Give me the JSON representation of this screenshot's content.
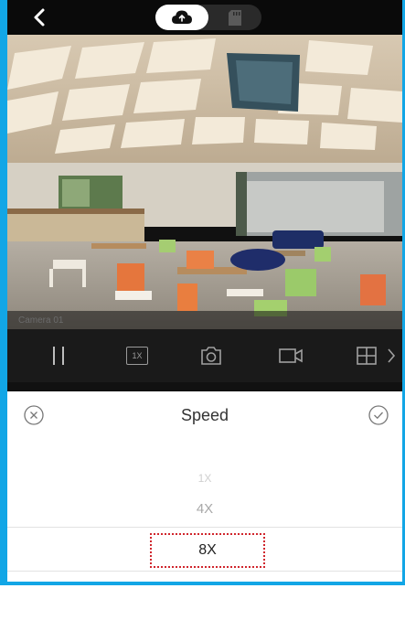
{
  "top_bar": {
    "back_icon": "chevron-left-icon",
    "source_toggle": {
      "selected": "cloud",
      "options": [
        "cloud-icon",
        "sd-card-icon"
      ]
    }
  },
  "video": {
    "camera_label": "Camera 01"
  },
  "toolbar": {
    "speed_badge": "1X",
    "icons": [
      "pause-icon",
      "speed-icon",
      "snapshot-icon",
      "record-icon",
      "grid-icon",
      "chevron-right-icon"
    ]
  },
  "speed_sheet": {
    "title": "Speed",
    "options": [
      "1X",
      "4X",
      "8X"
    ],
    "selected": "8X"
  },
  "colors": {
    "frame": "#12a6e6",
    "highlight": "#d0262d"
  }
}
